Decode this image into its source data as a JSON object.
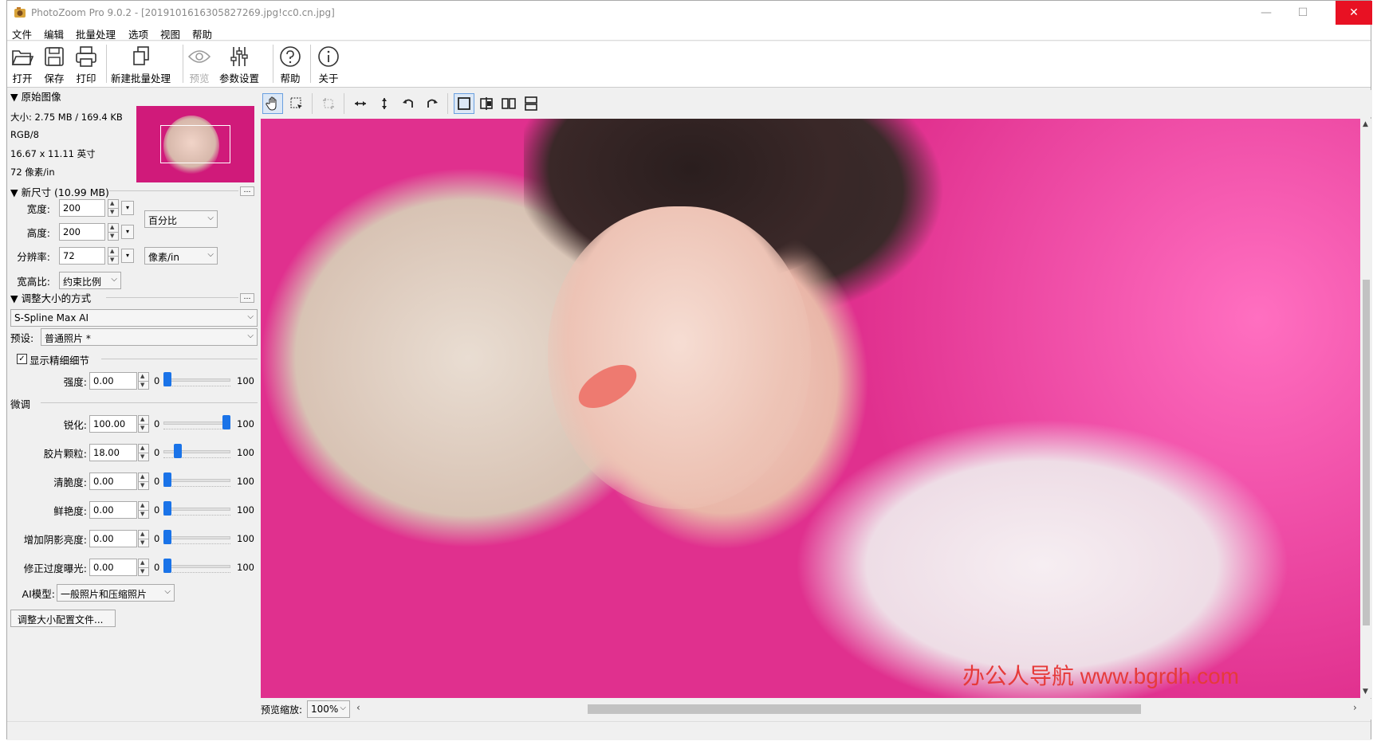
{
  "window": {
    "title": "PhotoZoom Pro 9.0.2 - [20191016163058272­69.jpg!cc0.cn.jpg]",
    "minimize": "—",
    "maximize": "☐",
    "close": "✕"
  },
  "menu": [
    "文件",
    "编辑",
    "批量处理",
    "选项",
    "视图",
    "帮助"
  ],
  "toolbar": {
    "open": "打开",
    "save": "保存",
    "print": "打印",
    "new_batch": "新建批量处理",
    "preview": "预览",
    "settings": "参数设置",
    "help": "帮助",
    "about": "关于"
  },
  "original": {
    "header": "▼ 原始图像",
    "size": "大小: 2.75 MB / 169.4 KB",
    "mode": "RGB/8",
    "dimensions": "16.67 x 11.11 英寸",
    "resolution": "72 像素/in"
  },
  "new_size": {
    "header": "▼ 新尺寸 (10.99 MB)",
    "width_label": "宽度:",
    "width_value": "200",
    "height_label": "高度:",
    "height_value": "200",
    "unit": "百分比",
    "resolution_label": "分辨率:",
    "resolution_value": "72",
    "resolution_unit": "像素/in",
    "aspect_label": "宽高比:",
    "aspect_value": "约束比例"
  },
  "resize": {
    "header": "▼ 调整大小的方式",
    "method": "S-Spline Max AI",
    "preset_label": "预设:",
    "preset_value": "普通照片 *",
    "show_detail": "显示精细细节",
    "show_detail_checked": "✓",
    "strength_label": "强度:",
    "strength_value": "0.00",
    "strength_level": 0.0,
    "fine_tune": "微调",
    "sharpen_label": "锐化:",
    "sharpen_value": "100.00",
    "sharpen_level": 100.0,
    "grain_label": "胶片颗粒:",
    "grain_value": "18.00",
    "grain_level": 18.0,
    "crisp_label": "清脆度:",
    "crisp_value": "0.00",
    "crisp_level": 0.0,
    "vivid_label": "鲜艳度:",
    "vivid_value": "0.00",
    "vivid_level": 0.0,
    "shadow_label": "增加阴影亮度:",
    "shadow_value": "0.00",
    "shadow_level": 0.0,
    "overexp_label": "修正过度曝光:",
    "overexp_value": "0.00",
    "overexp_level": 0.0,
    "min": "0",
    "max": "100",
    "ai_label": "AI模型:",
    "ai_value": "一般照片和压缩照片",
    "profile_button": "调整大小配置文件..."
  },
  "preview": {
    "zoom_label": "预览缩放:",
    "zoom_value": "100%",
    "watermark": "办公人导航  www.bgrdh.com"
  },
  "colors": {
    "accent": "#1a73e8",
    "close": "#e81123"
  }
}
